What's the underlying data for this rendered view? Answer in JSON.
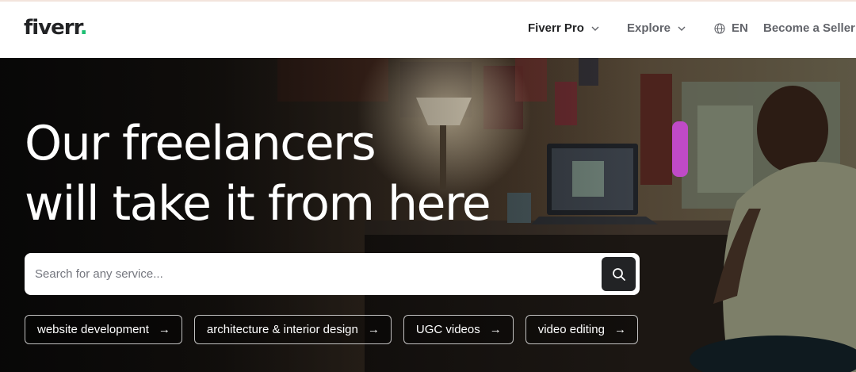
{
  "header": {
    "logo_text": "fiverr",
    "logo_dot": ".",
    "nav": {
      "pro_label": "Fiverr Pro",
      "explore_label": "Explore",
      "language_label": "EN",
      "seller_label": "Become a Seller"
    }
  },
  "hero": {
    "headline_line1": "Our freelancers",
    "headline_line2": "will take it from here",
    "search": {
      "placeholder": "Search for any service...",
      "value": ""
    },
    "chips": [
      {
        "label": "website development",
        "icon": "arrow-right-icon"
      },
      {
        "label": "architecture & interior design",
        "icon": "arrow-right-icon"
      },
      {
        "label": "UGC videos",
        "icon": "arrow-right-icon"
      },
      {
        "label": "video editing",
        "icon": "arrow-right-icon"
      }
    ]
  },
  "colors": {
    "brand_green": "#1dbf73",
    "text_dark": "#222325",
    "search_button": "#222325"
  }
}
